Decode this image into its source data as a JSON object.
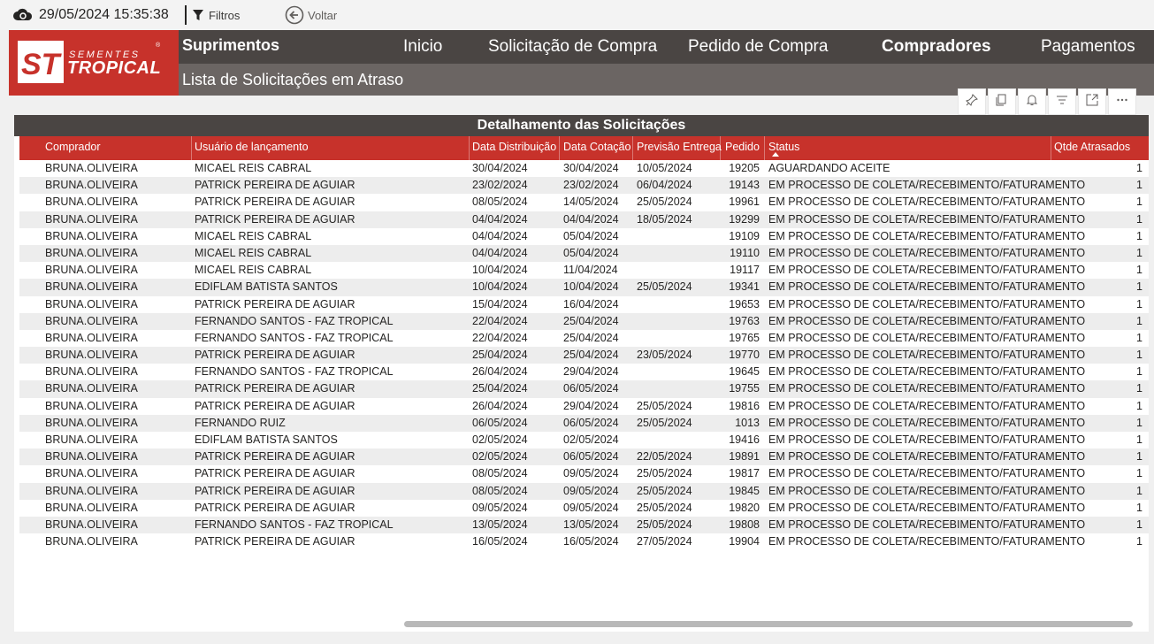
{
  "topbar": {
    "datetime": "29/05/2024 15:35:38",
    "filtros_label": "Filtros",
    "voltar_label": "Voltar"
  },
  "header": {
    "logo_small": "SEMENTES",
    "logo_big": "TROPICAL",
    "logo_mark": "ST",
    "app_title": "Suprimentos",
    "page_title": "Lista de Solicitações em Atraso",
    "nav": [
      {
        "label": "Inicio"
      },
      {
        "label": "Solicitação de Compra"
      },
      {
        "label": "Pedido de Compra"
      },
      {
        "label": "Compradores",
        "active": true
      },
      {
        "label": "Pagamentos"
      }
    ]
  },
  "visual_toolbar": [
    "pin-icon",
    "copy-icon",
    "bell-icon",
    "filter-icon",
    "focus-mode-icon",
    "more-options-icon"
  ],
  "table": {
    "title": "Detalhamento das Solicitações",
    "columns": [
      "Comprador",
      "Usuário de lançamento",
      "Data Distribuição",
      "Data Cotação",
      "Previsão Entrega",
      "Pedido",
      "Status",
      "Qtde Atrasados"
    ],
    "rows": [
      [
        "BRUNA.OLIVEIRA",
        "MICAEL REIS CABRAL",
        "30/04/2024",
        "30/04/2024",
        "10/05/2024",
        "19205",
        "AGUARDANDO ACEITE",
        "1"
      ],
      [
        "BRUNA.OLIVEIRA",
        "PATRICK PEREIRA DE AGUIAR",
        "23/02/2024",
        "23/02/2024",
        "06/04/2024",
        "19143",
        "EM PROCESSO DE COLETA/RECEBIMENTO/FATURAMENTO",
        "1"
      ],
      [
        "BRUNA.OLIVEIRA",
        "PATRICK PEREIRA DE AGUIAR",
        "08/05/2024",
        "14/05/2024",
        "25/05/2024",
        "19961",
        "EM PROCESSO DE COLETA/RECEBIMENTO/FATURAMENTO",
        "1"
      ],
      [
        "BRUNA.OLIVEIRA",
        "PATRICK PEREIRA DE AGUIAR",
        "04/04/2024",
        "04/04/2024",
        "18/05/2024",
        "19299",
        "EM PROCESSO DE COLETA/RECEBIMENTO/FATURAMENTO",
        "1"
      ],
      [
        "BRUNA.OLIVEIRA",
        "MICAEL REIS CABRAL",
        "04/04/2024",
        "05/04/2024",
        "",
        "19109",
        "EM PROCESSO DE COLETA/RECEBIMENTO/FATURAMENTO",
        "1"
      ],
      [
        "BRUNA.OLIVEIRA",
        "MICAEL REIS CABRAL",
        "04/04/2024",
        "05/04/2024",
        "",
        "19110",
        "EM PROCESSO DE COLETA/RECEBIMENTO/FATURAMENTO",
        "1"
      ],
      [
        "BRUNA.OLIVEIRA",
        "MICAEL REIS CABRAL",
        "10/04/2024",
        "11/04/2024",
        "",
        "19117",
        "EM PROCESSO DE COLETA/RECEBIMENTO/FATURAMENTO",
        "1"
      ],
      [
        "BRUNA.OLIVEIRA",
        "EDIFLAM BATISTA SANTOS",
        "10/04/2024",
        "10/04/2024",
        "25/05/2024",
        "19341",
        "EM PROCESSO DE COLETA/RECEBIMENTO/FATURAMENTO",
        "1"
      ],
      [
        "BRUNA.OLIVEIRA",
        "PATRICK PEREIRA DE AGUIAR",
        "15/04/2024",
        "16/04/2024",
        "",
        "19653",
        "EM PROCESSO DE COLETA/RECEBIMENTO/FATURAMENTO",
        "1"
      ],
      [
        "BRUNA.OLIVEIRA",
        "FERNANDO SANTOS - FAZ TROPICAL",
        "22/04/2024",
        "25/04/2024",
        "",
        "19763",
        "EM PROCESSO DE COLETA/RECEBIMENTO/FATURAMENTO",
        "1"
      ],
      [
        "BRUNA.OLIVEIRA",
        "FERNANDO SANTOS - FAZ TROPICAL",
        "22/04/2024",
        "25/04/2024",
        "",
        "19765",
        "EM PROCESSO DE COLETA/RECEBIMENTO/FATURAMENTO",
        "1"
      ],
      [
        "BRUNA.OLIVEIRA",
        "PATRICK PEREIRA DE AGUIAR",
        "25/04/2024",
        "25/04/2024",
        "23/05/2024",
        "19770",
        "EM PROCESSO DE COLETA/RECEBIMENTO/FATURAMENTO",
        "1"
      ],
      [
        "BRUNA.OLIVEIRA",
        "FERNANDO SANTOS - FAZ TROPICAL",
        "26/04/2024",
        "29/04/2024",
        "",
        "19645",
        "EM PROCESSO DE COLETA/RECEBIMENTO/FATURAMENTO",
        "1"
      ],
      [
        "BRUNA.OLIVEIRA",
        "PATRICK PEREIRA DE AGUIAR",
        "25/04/2024",
        "06/05/2024",
        "",
        "19755",
        "EM PROCESSO DE COLETA/RECEBIMENTO/FATURAMENTO",
        "1"
      ],
      [
        "BRUNA.OLIVEIRA",
        "PATRICK PEREIRA DE AGUIAR",
        "26/04/2024",
        "29/04/2024",
        "25/05/2024",
        "19816",
        "EM PROCESSO DE COLETA/RECEBIMENTO/FATURAMENTO",
        "1"
      ],
      [
        "BRUNA.OLIVEIRA",
        "FERNANDO RUIZ",
        "06/05/2024",
        "06/05/2024",
        "25/05/2024",
        "1013",
        "EM PROCESSO DE COLETA/RECEBIMENTO/FATURAMENTO",
        "1"
      ],
      [
        "BRUNA.OLIVEIRA",
        "EDIFLAM BATISTA SANTOS",
        "02/05/2024",
        "02/05/2024",
        "",
        "19416",
        "EM PROCESSO DE COLETA/RECEBIMENTO/FATURAMENTO",
        "1"
      ],
      [
        "BRUNA.OLIVEIRA",
        "PATRICK PEREIRA DE AGUIAR",
        "02/05/2024",
        "06/05/2024",
        "22/05/2024",
        "19891",
        "EM PROCESSO DE COLETA/RECEBIMENTO/FATURAMENTO",
        "1"
      ],
      [
        "BRUNA.OLIVEIRA",
        "PATRICK PEREIRA DE AGUIAR",
        "08/05/2024",
        "09/05/2024",
        "25/05/2024",
        "19817",
        "EM PROCESSO DE COLETA/RECEBIMENTO/FATURAMENTO",
        "1"
      ],
      [
        "BRUNA.OLIVEIRA",
        "PATRICK PEREIRA DE AGUIAR",
        "08/05/2024",
        "09/05/2024",
        "25/05/2024",
        "19845",
        "EM PROCESSO DE COLETA/RECEBIMENTO/FATURAMENTO",
        "1"
      ],
      [
        "BRUNA.OLIVEIRA",
        "PATRICK PEREIRA DE AGUIAR",
        "09/05/2024",
        "09/05/2024",
        "25/05/2024",
        "19820",
        "EM PROCESSO DE COLETA/RECEBIMENTO/FATURAMENTO",
        "1"
      ],
      [
        "BRUNA.OLIVEIRA",
        "FERNANDO SANTOS - FAZ TROPICAL",
        "13/05/2024",
        "13/05/2024",
        "25/05/2024",
        "19808",
        "EM PROCESSO DE COLETA/RECEBIMENTO/FATURAMENTO",
        "1"
      ],
      [
        "BRUNA.OLIVEIRA",
        "PATRICK PEREIRA DE AGUIAR",
        "16/05/2024",
        "16/05/2024",
        "27/05/2024",
        "19904",
        "EM PROCESSO DE COLETA/RECEBIMENTO/FATURAMENTO",
        "1"
      ]
    ]
  },
  "colors": {
    "brand_red": "#c7322b",
    "header_dark": "#4a4543",
    "header_sub": "#6b6563"
  }
}
